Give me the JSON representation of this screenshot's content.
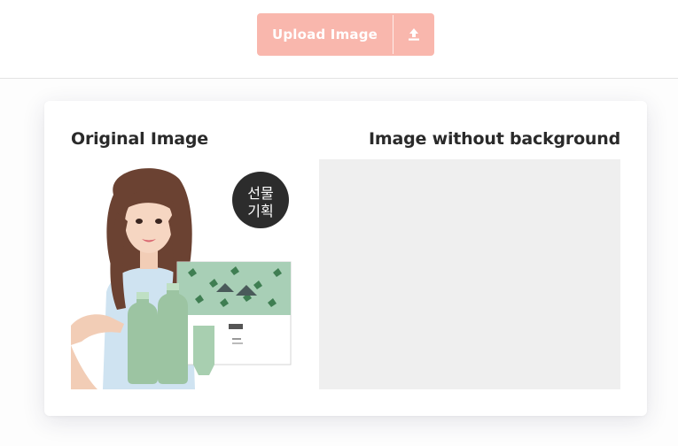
{
  "upload": {
    "label": "Upload Image",
    "icon": "upload-icon"
  },
  "card": {
    "original_title": "Original Image",
    "result_title": "Image without background"
  },
  "product_image": {
    "badge_line1": "선물",
    "badge_line2": "기획"
  },
  "colors": {
    "accent": "#f9b7ad",
    "card_bg": "#ffffff",
    "placeholder_bg": "#efefef"
  }
}
